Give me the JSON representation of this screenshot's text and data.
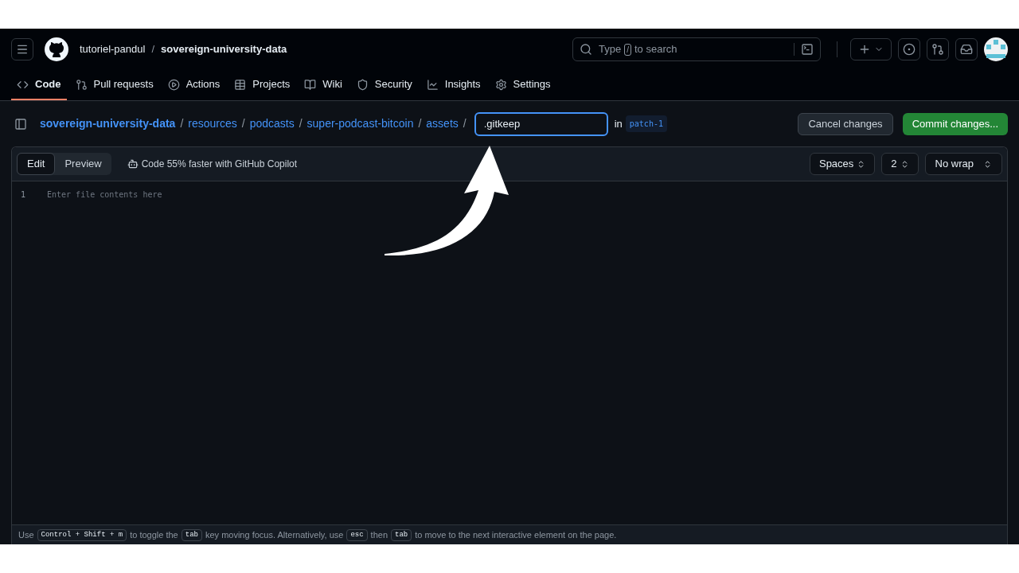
{
  "header": {
    "owner": "tutoriel-pandul",
    "separator": "/",
    "repo": "sovereign-university-data",
    "search": {
      "before": "Type",
      "key": "/",
      "after": "to search"
    }
  },
  "tabs": [
    {
      "label": "Code",
      "selected": true
    },
    {
      "label": "Pull requests",
      "selected": false
    },
    {
      "label": "Actions",
      "selected": false
    },
    {
      "label": "Projects",
      "selected": false
    },
    {
      "label": "Wiki",
      "selected": false
    },
    {
      "label": "Security",
      "selected": false
    },
    {
      "label": "Insights",
      "selected": false
    },
    {
      "label": "Settings",
      "selected": false
    }
  ],
  "breadcrumb": {
    "segments": [
      {
        "label": "sovereign-university-data",
        "kind": "root"
      },
      {
        "label": "resources",
        "kind": "dir"
      },
      {
        "label": "podcasts",
        "kind": "dir"
      },
      {
        "label": "super-podcast-bitcoin",
        "kind": "dir"
      },
      {
        "label": "assets",
        "kind": "dir"
      }
    ],
    "separator": "/",
    "filename": ".gitkeep",
    "in": "in",
    "branch": "patch-1"
  },
  "actions": {
    "cancel": "Cancel changes",
    "commit": "Commit changes..."
  },
  "editor": {
    "modes": [
      {
        "label": "Edit",
        "selected": true
      },
      {
        "label": "Preview",
        "selected": false
      }
    ],
    "copilot": "Code 55% faster with GitHub Copilot",
    "selects": [
      "Spaces",
      "2",
      "No wrap"
    ],
    "lines": [
      {
        "number": "1",
        "placeholder": "Enter file contents here"
      }
    ]
  },
  "footer": [
    {
      "kind": "text",
      "text": "Use"
    },
    {
      "kind": "kbd",
      "text": "Control + Shift + m"
    },
    {
      "kind": "text",
      "text": "to toggle the"
    },
    {
      "kind": "kbd",
      "text": "tab"
    },
    {
      "kind": "text",
      "text": "key moving focus. Alternatively, use"
    },
    {
      "kind": "kbd",
      "text": "esc"
    },
    {
      "kind": "text",
      "text": "then"
    },
    {
      "kind": "kbd",
      "text": "tab"
    },
    {
      "kind": "text",
      "text": "to move to the next interactive element on the page."
    }
  ]
}
